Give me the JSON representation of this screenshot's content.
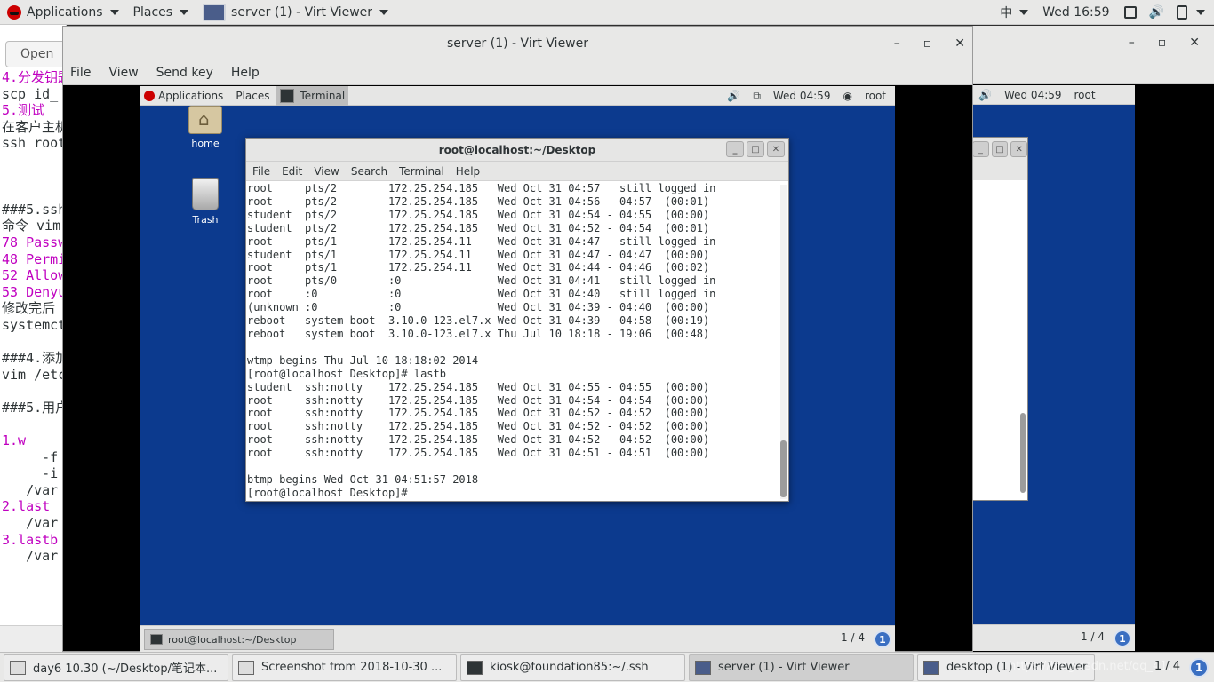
{
  "host_topbar": {
    "applications": "Applications",
    "places": "Places",
    "window_title": "server (1) - Virt Viewer",
    "input_method": "中",
    "clock": "Wed 16:59"
  },
  "editor": {
    "open_label": "Open",
    "lines": [
      "4.分发钥匙",
      "scp id_",
      "5.测试",
      "在客户主机",
      "ssh root",
      "",
      "",
      "",
      "###5.ssh",
      "命令 vim",
      "78 Passw",
      "48 Permi",
      "52 Allow",
      "53 Denyu",
      "修改完后",
      "systemct",
      "",
      "###4.添加",
      "vim /etc",
      "",
      "###5.用户",
      "",
      "1.w",
      "     -f",
      "     -i",
      "   /var",
      "2.last",
      "   /var",
      "3.lastb",
      "   /var"
    ]
  },
  "vv1": {
    "title": "server (1) - Virt Viewer",
    "menu": [
      "File",
      "View",
      "Send key",
      "Help"
    ]
  },
  "guest1": {
    "applications": "Applications",
    "places": "Places",
    "terminal_tab": "Terminal",
    "clock": "Wed 04:59",
    "user": "root",
    "icons": {
      "home": "home",
      "trash": "Trash"
    },
    "terminal": {
      "title": "root@localhost:~/Desktop",
      "menu": [
        "File",
        "Edit",
        "View",
        "Search",
        "Terminal",
        "Help"
      ],
      "lines": [
        "root     pts/2        172.25.254.185   Wed Oct 31 04:57   still logged in",
        "root     pts/2        172.25.254.185   Wed Oct 31 04:56 - 04:57  (00:01)",
        "student  pts/2        172.25.254.185   Wed Oct 31 04:54 - 04:55  (00:00)",
        "student  pts/2        172.25.254.185   Wed Oct 31 04:52 - 04:54  (00:01)",
        "root     pts/1        172.25.254.11    Wed Oct 31 04:47   still logged in",
        "student  pts/1        172.25.254.11    Wed Oct 31 04:47 - 04:47  (00:00)",
        "root     pts/1        172.25.254.11    Wed Oct 31 04:44 - 04:46  (00:02)",
        "root     pts/0        :0               Wed Oct 31 04:41   still logged in",
        "root     :0           :0               Wed Oct 31 04:40   still logged in",
        "(unknown :0           :0               Wed Oct 31 04:39 - 04:40  (00:00)",
        "reboot   system boot  3.10.0-123.el7.x Wed Oct 31 04:39 - 04:58  (00:19)",
        "reboot   system boot  3.10.0-123.el7.x Thu Jul 10 18:18 - 19:06  (00:48)",
        "",
        "wtmp begins Thu Jul 10 18:18:02 2014",
        "[root@localhost Desktop]# lastb",
        "student  ssh:notty    172.25.254.185   Wed Oct 31 04:55 - 04:55  (00:00)",
        "root     ssh:notty    172.25.254.185   Wed Oct 31 04:54 - 04:54  (00:00)",
        "root     ssh:notty    172.25.254.185   Wed Oct 31 04:52 - 04:52  (00:00)",
        "root     ssh:notty    172.25.254.185   Wed Oct 31 04:52 - 04:52  (00:00)",
        "root     ssh:notty    172.25.254.185   Wed Oct 31 04:52 - 04:52  (00:00)",
        "root     ssh:notty    172.25.254.185   Wed Oct 31 04:51 - 04:51  (00:00)",
        "",
        "btmp begins Wed Oct 31 04:51:57 2018",
        "[root@localhost Desktop]#"
      ]
    },
    "taskbar_task": "root@localhost:~/Desktop",
    "pager": "1 / 4",
    "pager_badge": "1"
  },
  "guest2": {
    "clock": "Wed 04:59",
    "user": "root",
    "pager": "1 / 4",
    "pager_badge": "1"
  },
  "host_taskbar": {
    "tasks": [
      "day6 10.30 (~/Desktop/笔记本...",
      "Screenshot from 2018-10-30 ...",
      "kiosk@foundation85:~/.ssh",
      "server (1) - Virt Viewer",
      "desktop (1) - Virt Viewer"
    ],
    "pager": "1 / 4",
    "pager_badge": "1",
    "watermark": "https://blog.csdn.net/qq_41..."
  },
  "colors": {
    "guest_desktop": "#0c3a8e",
    "accent": "#3a6fc2"
  }
}
